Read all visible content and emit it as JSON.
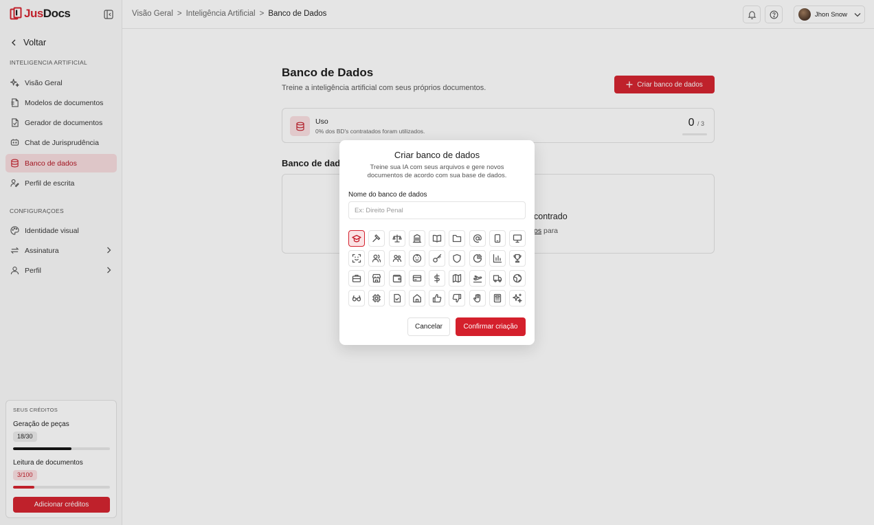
{
  "brand": {
    "name_prefix": "Jus",
    "name_suffix": "Docs"
  },
  "sidebar": {
    "back_label": "Voltar",
    "section_ai": "INTELIGENCIA ARTIFICIAL",
    "section_config": "CONFIGURAÇOES",
    "items": [
      {
        "label": "Visão Geral",
        "icon": "sparkles-icon"
      },
      {
        "label": "Modelos de documentos",
        "icon": "file-icon"
      },
      {
        "label": "Gerador de documentos",
        "icon": "file-gen-icon"
      },
      {
        "label": "Chat de Jurisprudência",
        "icon": "chat-icon"
      },
      {
        "label": "Banco de dados",
        "icon": "database-icon",
        "active": true
      },
      {
        "label": "Perfil de escrita",
        "icon": "writing-icon"
      }
    ],
    "config_items": [
      {
        "label": "Identidade visual",
        "icon": "palette-icon"
      },
      {
        "label": "Assinatura",
        "icon": "repeat-icon"
      },
      {
        "label": "Perfil",
        "icon": "user-icon"
      }
    ],
    "credits": {
      "title": "SEUS CRÉDITOS",
      "generation_label": "Geração de peças",
      "generation_value": "18/30",
      "generation_progress": 0.6,
      "reading_label": "Leitura de documentos",
      "reading_value": "3/100",
      "reading_progress": 0.03,
      "add_button": "Adicionar créditos"
    }
  },
  "topbar": {
    "breadcrumb": [
      "Visão Geral",
      "Inteligência Artificial",
      "Banco de Dados"
    ],
    "user_name": "Jhon Snow"
  },
  "main": {
    "title": "Banco de Dados",
    "subtitle": "Treine a inteligência artificial com seus próprios documentos.",
    "create_button": "Criar banco de dados",
    "usage": {
      "title": "Uso",
      "subtitle": "0% dos BD's contratados foram utilizados.",
      "count": "0",
      "total": "/ 3"
    },
    "list_title": "Banco de dado",
    "empty_title": "contrado",
    "empty_link": "os",
    "empty_suffix": " para"
  },
  "modal": {
    "title": "Criar banco de dados",
    "description": "Treine sua IA com seus arquivos e gere novos documentos de acordo com sua base de dados.",
    "name_label": "Nome do banco de dados",
    "name_placeholder": "Ex: Direito Penal",
    "name_value": "",
    "selected_icon": "graduation-cap-icon",
    "cancel": "Cancelar",
    "confirm": "Confirmar criação"
  },
  "colors": {
    "accent": "#d4202c",
    "accent_soft": "#fbe0e2"
  }
}
